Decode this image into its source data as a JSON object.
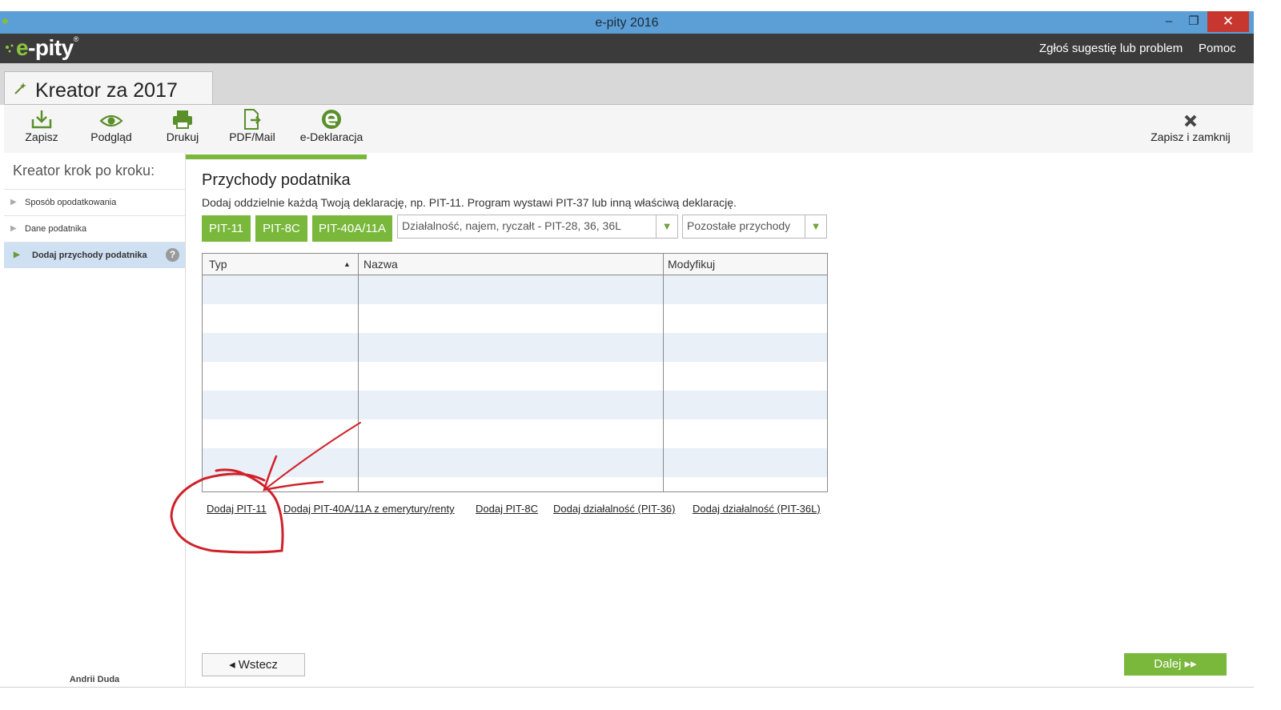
{
  "window": {
    "title": "e-pity 2016",
    "minimize": "‒",
    "maximize": "❐",
    "close": "✕"
  },
  "header": {
    "logo_e": "e",
    "logo_rest": "-pity",
    "logo_reg": "®",
    "report_link": "Zgłoś sugestię lub problem",
    "help_link": "Pomoc"
  },
  "tab": {
    "title": "Kreator za 2017"
  },
  "toolbar": {
    "save": "Zapisz",
    "preview": "Podgląd",
    "print": "Drukuj",
    "pdf_mail": "PDF/Mail",
    "e_declaration": "e-Deklaracja",
    "save_close": "Zapisz i zamknij"
  },
  "sidebar": {
    "title": "Kreator krok po kroku:",
    "items": [
      {
        "label": "Sposób opodatkowania"
      },
      {
        "label": "Dane podatnika"
      },
      {
        "label": "Dodaj przychody podatnika"
      }
    ],
    "help": "?",
    "user": "Andrii Duda"
  },
  "main": {
    "title": "Przychody podatnika",
    "description": "Dodaj oddzielnie każdą Twoją deklarację, np. PIT-11. Program wystawi PIT-37 lub inną właściwą deklarację.",
    "buttons": [
      "PIT-11",
      "PIT-8C",
      "PIT-40A/11A"
    ],
    "dropdown_business": "Działalność, najem, ryczałt - PIT-28, 36, 36L",
    "dropdown_other": "Pozostałe przychody",
    "table": {
      "columns": [
        "Typ",
        "Nazwa",
        "Modyfikuj"
      ],
      "sort_indicator": "▲",
      "rows": []
    },
    "links": [
      "Dodaj PIT-11",
      "Dodaj PIT-40A/11A z emerytury/renty",
      "Dodaj PIT-8C",
      "Dodaj działalność (PIT-36)",
      "Dodaj działalność (PIT-36L)"
    ],
    "back": "◂ Wstecz",
    "next": "Dalej ▸▸"
  },
  "colors": {
    "accent_green": "#7ab83c",
    "titlebar_blue": "#5b9fd6",
    "header_dark": "#3b3b3b",
    "close_red": "#c7372f",
    "annotation_red": "#d0212a"
  },
  "progress": 0.2
}
